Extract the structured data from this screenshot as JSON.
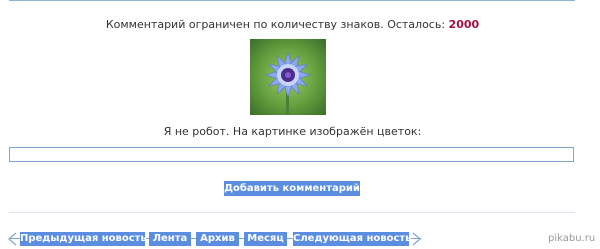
{
  "comment_limit": {
    "text": "Комментарий ограничен по количеству знаков. Осталось:",
    "remaining": "2000"
  },
  "captcha": {
    "image_subject": "cornflower",
    "question": "Я не робот. На картинке изображён цветок:",
    "input_value": ""
  },
  "form": {
    "submit_label": "Добавить комментарий"
  },
  "nav": {
    "prev_label": "Предыдущая новость",
    "feed_label": "Лента",
    "archive_label": "Архив",
    "month_label": "Месяц",
    "next_label": "Следующая новость"
  },
  "watermark": "pikabu.ru",
  "colors": {
    "accent": "#5b8ee0",
    "counter_number": "#a1123d",
    "border": "#7ea6cf"
  }
}
